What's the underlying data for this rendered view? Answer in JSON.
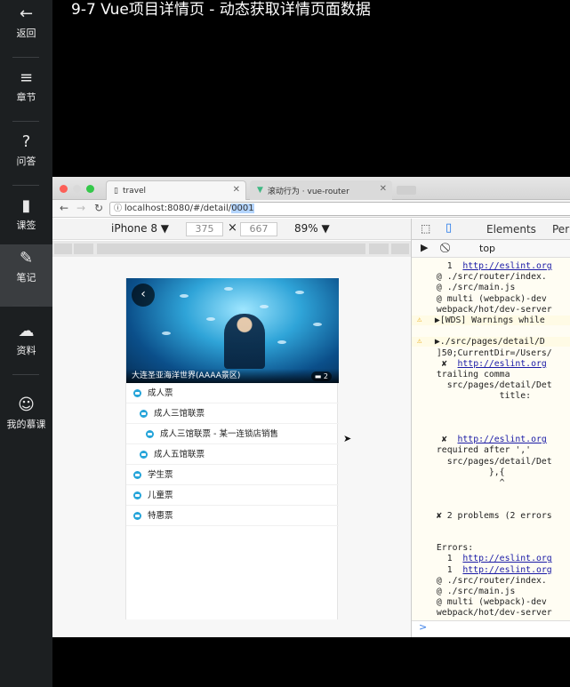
{
  "sidebar": {
    "items": [
      {
        "label": "返回",
        "icon": "arrow-left-icon"
      },
      {
        "label": "章节",
        "icon": "menu-icon"
      },
      {
        "label": "问答",
        "icon": "question-icon"
      },
      {
        "label": "课签",
        "icon": "bookmark-icon"
      },
      {
        "label": "笔记",
        "icon": "pencil-icon"
      },
      {
        "label": "资料",
        "icon": "cloud-download-icon"
      },
      {
        "label": "我的慕课",
        "icon": "avatar-icon"
      }
    ]
  },
  "course_title": "9-7 Vue项目详情页 - 动态获取详情页面数据",
  "browser": {
    "tabs": [
      {
        "title": "travel"
      },
      {
        "title": "滚动行为 · vue-router"
      }
    ],
    "url_main": "localhost:8080/#/detail/",
    "url_selected": "0001",
    "device": {
      "name": "iPhone 8 ▼",
      "width": "375",
      "times": "×",
      "height": "667",
      "zoom": "89% ▼"
    }
  },
  "page": {
    "banner_title": "大连圣亚海洋世界(AAAA景区)",
    "image_count": "2",
    "back_symbol": "‹",
    "tickets": [
      {
        "label": "成人票",
        "level": 0
      },
      {
        "label": "成人三馆联票",
        "level": 1
      },
      {
        "label": "成人三馆联票 - 某一连锁店销售",
        "level": 2
      },
      {
        "label": "成人五馆联票",
        "level": 1
      },
      {
        "label": "学生票",
        "level": 0
      },
      {
        "label": "儿童票",
        "level": 0
      },
      {
        "label": "特惠票",
        "level": 0
      }
    ]
  },
  "devtools": {
    "tabs": {
      "elements": "Elements",
      "more": "Per"
    },
    "context": "top",
    "lines": [
      {
        "t": "   1  ",
        "l": "http://eslint.org"
      },
      {
        "t": " @ ./src/router/index."
      },
      {
        "t": " @ ./src/main.js"
      },
      {
        "t": " @ multi (webpack)-dev"
      },
      {
        "t": " webpack/hot/dev-server"
      },
      {
        "t": " ▶[WDS] Warnings while",
        "warn": true
      },
      {
        "t": ""
      },
      {
        "t": " ▶./src/pages/detail/D",
        "warn": true
      },
      {
        "t": " ]50;CurrentDir=/Users/"
      },
      {
        "t": "  ✘  ",
        "l": "http://eslint.org"
      },
      {
        "t": " trailing comma"
      },
      {
        "t": "   src/pages/detail/Det"
      },
      {
        "t": "             title:"
      },
      {
        "t": ""
      },
      {
        "t": ""
      },
      {
        "t": ""
      },
      {
        "t": "  ✘  ",
        "l": "http://eslint.org"
      },
      {
        "t": " required after ','"
      },
      {
        "t": "   src/pages/detail/Det"
      },
      {
        "t": "           },{"
      },
      {
        "t": "             ^"
      },
      {
        "t": ""
      },
      {
        "t": ""
      },
      {
        "t": " ✘ 2 problems (2 errors"
      },
      {
        "t": ""
      },
      {
        "t": ""
      },
      {
        "t": " Errors:"
      },
      {
        "t": "   1  ",
        "l": "http://eslint.org"
      },
      {
        "t": "   1  ",
        "l": "http://eslint.org"
      },
      {
        "t": " @ ./src/router/index."
      },
      {
        "t": " @ ./src/main.js"
      },
      {
        "t": " @ multi (webpack)-dev"
      },
      {
        "t": " webpack/hot/dev-server"
      }
    ],
    "prompt": ">"
  }
}
